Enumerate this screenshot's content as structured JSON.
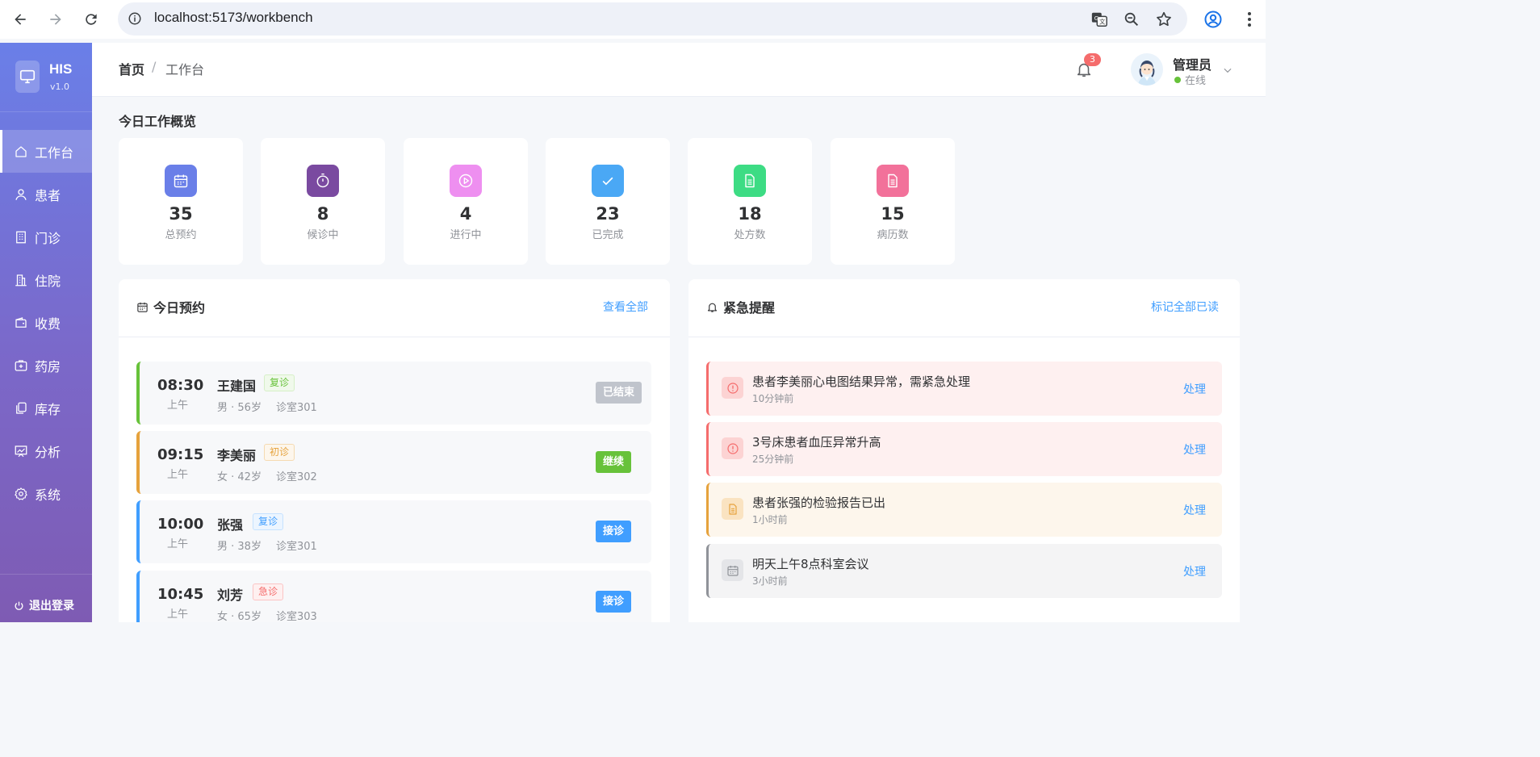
{
  "browser": {
    "url": "localhost:5173/workbench"
  },
  "sidebar": {
    "logo_name": "HIS",
    "version": "v1.0",
    "items": [
      {
        "label": "工作台",
        "icon": "home-icon"
      },
      {
        "label": "患者",
        "icon": "user-icon"
      },
      {
        "label": "门诊",
        "icon": "building-icon"
      },
      {
        "label": "住院",
        "icon": "hospital-icon"
      },
      {
        "label": "收费",
        "icon": "wallet-icon"
      },
      {
        "label": "药房",
        "icon": "first-aid-icon"
      },
      {
        "label": "库存",
        "icon": "copy-icon"
      },
      {
        "label": "分析",
        "icon": "chart-icon"
      },
      {
        "label": "系统",
        "icon": "gear-icon"
      }
    ],
    "logout": "退出登录"
  },
  "header": {
    "breadcrumb_home": "首页",
    "breadcrumb_sep": "/",
    "breadcrumb_current": "工作台",
    "notification_count": "3",
    "user_name": "管理员",
    "user_status": "在线"
  },
  "overview": {
    "title": "今日工作概览",
    "stats": [
      {
        "value": "35",
        "label": "总预约",
        "color": "#6a7fe8",
        "icon": "calendar-icon"
      },
      {
        "value": "8",
        "label": "候诊中",
        "color": "#7a4aa0",
        "icon": "timer-icon"
      },
      {
        "value": "4",
        "label": "进行中",
        "color": "#ee8ff0",
        "icon": "play-icon"
      },
      {
        "value": "23",
        "label": "已完成",
        "color": "#4aa8f5",
        "icon": "check-icon"
      },
      {
        "value": "18",
        "label": "处方数",
        "color": "#3ddc84",
        "icon": "document-icon"
      },
      {
        "value": "15",
        "label": "病历数",
        "color": "#f2719a",
        "icon": "document-icon"
      }
    ]
  },
  "appointments": {
    "title": "今日预约",
    "view_all": "查看全部",
    "items": [
      {
        "time": "08:30",
        "ampm": "上午",
        "name": "王建国",
        "tag": "复诊",
        "tag_type": "green",
        "meta": "男 · 56岁",
        "room": "诊室301",
        "action": "已结束",
        "action_type": "done",
        "accent": "#67c23a"
      },
      {
        "time": "09:15",
        "ampm": "上午",
        "name": "李美丽",
        "tag": "初诊",
        "tag_type": "orange",
        "meta": "女 · 42岁",
        "room": "诊室302",
        "action": "继续",
        "action_type": "continue",
        "accent": "#e6a23c"
      },
      {
        "time": "10:00",
        "ampm": "上午",
        "name": "张强",
        "tag": "复诊",
        "tag_type": "blue",
        "meta": "男 · 38岁",
        "room": "诊室301",
        "action": "接诊",
        "action_type": "receive",
        "accent": "#409eff"
      },
      {
        "time": "10:45",
        "ampm": "上午",
        "name": "刘芳",
        "tag": "急诊",
        "tag_type": "red",
        "meta": "女 · 65岁",
        "room": "诊室303",
        "action": "接诊",
        "action_type": "receive",
        "accent": "#409eff"
      }
    ]
  },
  "alerts": {
    "title": "紧急提醒",
    "mark_all": "标记全部已读",
    "items": [
      {
        "text": "患者李美丽心电图结果异常，需紧急处理",
        "time": "10分钟前",
        "action": "处理",
        "type": "danger",
        "icon": "alert-circle-icon"
      },
      {
        "text": "3号床患者血压异常升高",
        "time": "25分钟前",
        "action": "处理",
        "type": "danger",
        "icon": "alert-circle-icon"
      },
      {
        "text": "患者张强的检验报告已出",
        "time": "1小时前",
        "action": "处理",
        "type": "warning",
        "icon": "report-icon"
      },
      {
        "text": "明天上午8点科室会议",
        "time": "3小时前",
        "action": "处理",
        "type": "info",
        "icon": "calendar-icon"
      }
    ]
  }
}
